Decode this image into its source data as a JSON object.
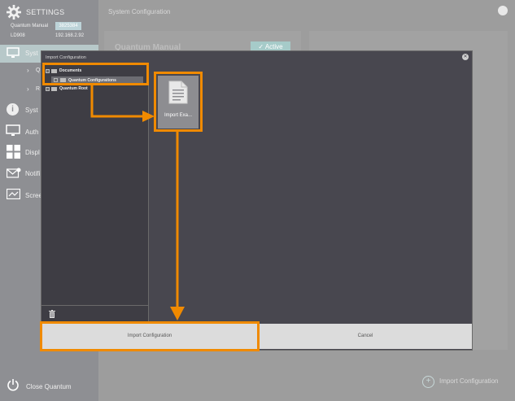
{
  "sidebar": {
    "title": "SETTINGS",
    "device_name": "Quantum Manual",
    "device_id": "3825384",
    "model": "LD908",
    "ip": "192.168.2.92",
    "items": [
      {
        "label": "Syst",
        "icon": "monitor-icon"
      },
      {
        "label": "Q",
        "icon": "chevron-right-icon"
      },
      {
        "label": "R",
        "icon": "chevron-right-icon"
      },
      {
        "label": "Syst",
        "icon": "info-icon"
      },
      {
        "label": "Auth",
        "icon": "monitor-icon"
      },
      {
        "label": "Displ",
        "icon": "grid-icon"
      },
      {
        "label": "Notifi",
        "icon": "mail-icon"
      },
      {
        "label": "Scree",
        "icon": "screen-icon"
      }
    ],
    "close_label": "Close Quantum"
  },
  "main": {
    "header_title": "System Configuration",
    "panel_title": "Quantum Manual",
    "status_label": "✓ Active",
    "import_label": "Import Configuration"
  },
  "dialog": {
    "title": "Import Configuration",
    "tree": [
      {
        "label": "Documents",
        "level": 0,
        "expanded": true
      },
      {
        "label": "Quantum Configurations",
        "level": 1,
        "selected": true
      },
      {
        "label": "Quantum Root",
        "level": 0,
        "expanded": false
      }
    ],
    "file": {
      "label": "Import Exa...",
      "icon": "document-icon"
    },
    "buttons": {
      "import": "Import Configuration",
      "cancel": "Cancel"
    }
  },
  "colors": {
    "accent": "#f08a00",
    "dialog_bg": "#48474f",
    "sidebar_bg": "#8e8f93"
  }
}
